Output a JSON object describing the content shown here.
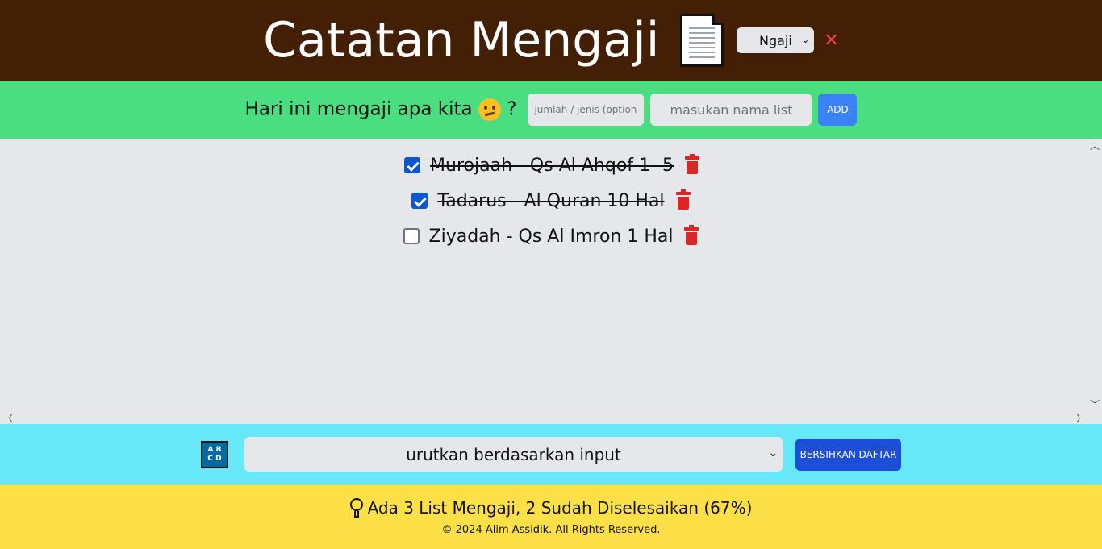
{
  "header": {
    "title": "Catatan Mengaji",
    "doc_icon": "document-icon",
    "category_select": "Ngaji",
    "close_label": "✕"
  },
  "add": {
    "prompt": "Hari ini mengaji apa kita",
    "prompt_suffix": "?",
    "emoji": "thinking-face-icon",
    "amount_placeholder": "jumlah / jenis (optional)",
    "name_placeholder": "masukan nama list",
    "add_label": "ADD"
  },
  "list": {
    "items": [
      {
        "text": "Murojaah - Qs Al Ahqof 1 -5",
        "done": true
      },
      {
        "text": "Tadarus - Al Quran 10 Hal",
        "done": true
      },
      {
        "text": "Ziyadah - Qs Al Imron 1 Hal",
        "done": false
      }
    ]
  },
  "sort": {
    "icon": "abcd-sort-icon",
    "icon_line1": "A B",
    "icon_line2": "C D",
    "selected": "urutkan berdasarkan input",
    "clear_label": "BERSIHKAN DAFTAR"
  },
  "footer": {
    "stats": "Ada 3 List Mengaji, 2 Sudah Diselesaikan (67%)",
    "copyright": "© 2024 Alim Assidik. All Rights Reserved."
  },
  "colors": {
    "header_bg": "#431f05",
    "add_bar_bg": "#4ade80",
    "sort_bar_bg": "#67e8f9",
    "footer_bg": "#fde047",
    "delete": "#dc2626"
  }
}
